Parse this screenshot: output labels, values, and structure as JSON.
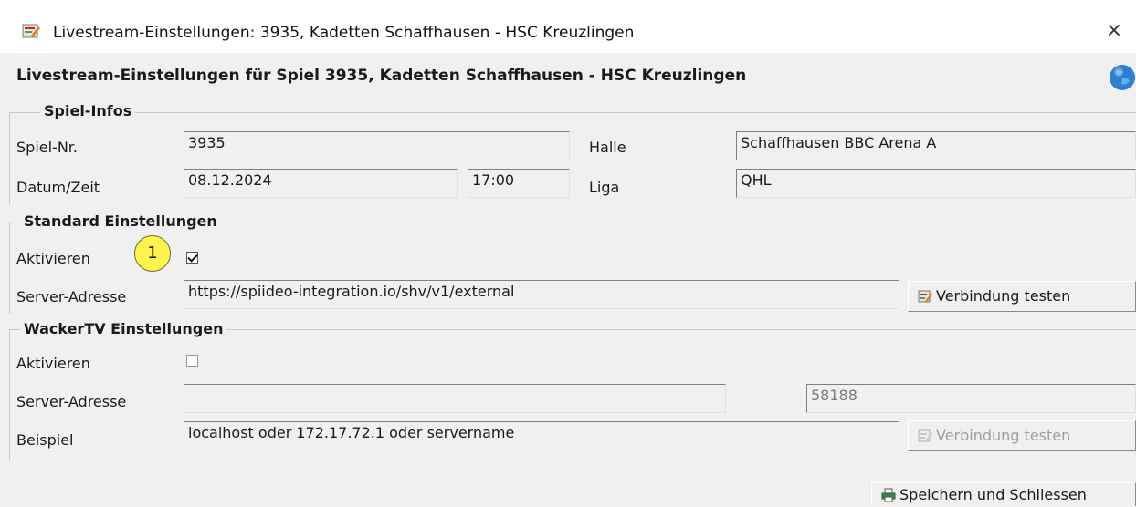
{
  "window": {
    "title": "Livestream-Einstellungen: 3935, Kadetten Schaffhausen - HSC Kreuzlingen",
    "close_glyph": "×",
    "app_icon": "edit-document-icon"
  },
  "header": {
    "title": "Livestream-Einstellungen für Spiel 3935, Kadetten Schaffhausen - HSC Kreuzlingen",
    "icon": "globe-icon"
  },
  "spiel_infos": {
    "legend": "Spiel-Infos",
    "spiel_nr_label": "Spiel-Nr.",
    "spiel_nr": "3935",
    "halle_label": "Halle",
    "halle": "Schaffhausen BBC Arena A",
    "datum_label": "Datum/Zeit",
    "datum": "08.12.2024",
    "zeit": "17:00",
    "liga_label": "Liga",
    "liga": "QHL"
  },
  "standard": {
    "legend": "Standard Einstellungen",
    "aktivieren_label": "Aktivieren",
    "aktivieren_checked": true,
    "callout_number": "1",
    "callout_color": "#fff34d",
    "server_label": "Server-Adresse",
    "server": "https://spiideo-integration.io/shv/v1/external",
    "test_button": "Verbindung testen"
  },
  "wackertv": {
    "legend": "WackerTV Einstellungen",
    "aktivieren_label": "Aktivieren",
    "aktivieren_checked": false,
    "server_label": "Server-Adresse",
    "server": "",
    "port": "58188",
    "beispiel_label": "Beispiel",
    "beispiel": "localhost oder 172.17.72.1 oder servername",
    "test_button": "Verbindung testen"
  },
  "footer": {
    "save_button": "Speichern und Schliessen",
    "save_icon": "printer-icon"
  }
}
